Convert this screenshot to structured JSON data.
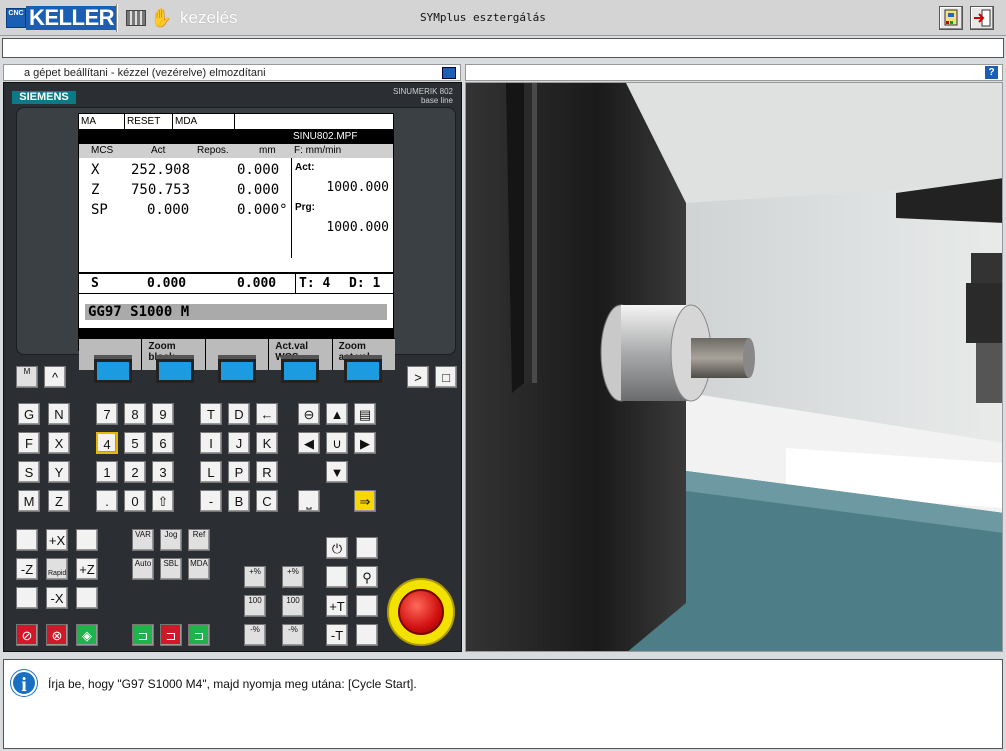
{
  "app": {
    "logo_small": "CNC",
    "logo": "KELLER",
    "mode": "kezelés",
    "title": "SYMplus esztergálás"
  },
  "left_header": "a gépet beállítani - kézzel (vezérelve) elmozdítani",
  "right_header_help": "?",
  "control": {
    "brand": "SIEMENS",
    "model_line1": "SINUMERIK 802",
    "model_line2": "base line",
    "status": [
      "MA",
      "RESET",
      "MDA",
      ""
    ],
    "program": "SINU802.MPF",
    "columns": {
      "coord": "MCS",
      "act": "Act",
      "repos": "Repos.",
      "unit": "mm",
      "feed": "F: mm/min"
    },
    "axes": [
      {
        "name": "X",
        "act": "252.908",
        "repos": "0.000"
      },
      {
        "name": "Z",
        "act": "750.753",
        "repos": "0.000"
      },
      {
        "name": "SP",
        "act": "0.000",
        "repos": "0.000°"
      }
    ],
    "feed": {
      "act_label": "Act:",
      "act": "1000.000",
      "prg_label": "Prg:",
      "prg": "1000.000"
    },
    "spindle": {
      "name": "S",
      "act": "0.000",
      "repos": "0.000",
      "tool": "T: 4",
      "d": "D: 1"
    },
    "mda_input": "GG97 S1000 M",
    "softkeys": [
      "",
      "Zoom\nblock",
      "",
      "Act.val\nWCS",
      "Zoom\nact.val"
    ]
  },
  "keys": {
    "alpha": [
      "G",
      "N",
      "F",
      "X",
      "S",
      "Y",
      "M",
      "Z"
    ],
    "num": [
      "7",
      "8",
      "9",
      "4",
      "5",
      "6",
      "1",
      "2",
      "3",
      ".",
      "0",
      "⇧"
    ],
    "alpha2": [
      "T",
      "D",
      "←",
      "I",
      "J",
      "K",
      "L",
      "P",
      "R",
      "-",
      "B",
      "C"
    ],
    "jog": [
      "+X",
      "-Z",
      "+Z",
      "-X"
    ],
    "jog_rapid": "Rapid",
    "fkeys": [
      "+T",
      "-T"
    ]
  },
  "info": "Írja be, hogy \"G97 S1000 M4\", majd nyomja meg utána: [Cycle Start]."
}
